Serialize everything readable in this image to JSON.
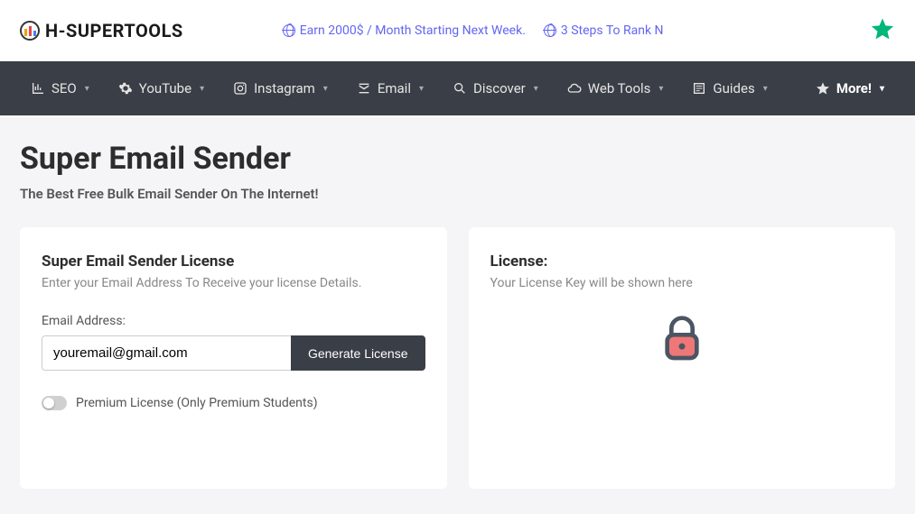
{
  "header": {
    "logo_text": "H-SUPERTOOLS",
    "promo_links": [
      "Earn 2000$ / Month Starting Next Week.",
      "3 Steps To Rank N"
    ]
  },
  "nav": {
    "items": [
      {
        "label": "SEO"
      },
      {
        "label": "YouTube"
      },
      {
        "label": "Instagram"
      },
      {
        "label": "Email"
      },
      {
        "label": "Discover"
      },
      {
        "label": "Web Tools"
      },
      {
        "label": "Guides"
      }
    ],
    "more_label": "More!"
  },
  "page": {
    "title": "Super Email Sender",
    "subtitle": "The Best Free Bulk Email Sender On The Internet!"
  },
  "form_card": {
    "title": "Super Email Sender License",
    "subtext": "Enter your Email Address To Receive your license Details.",
    "field_label": "Email Address:",
    "input_value": "youremail@gmail.com",
    "button_label": "Generate License",
    "toggle_label": "Premium License (Only Premium Students)"
  },
  "license_card": {
    "title": "License:",
    "subtext": "Your License Key will be shown here"
  }
}
